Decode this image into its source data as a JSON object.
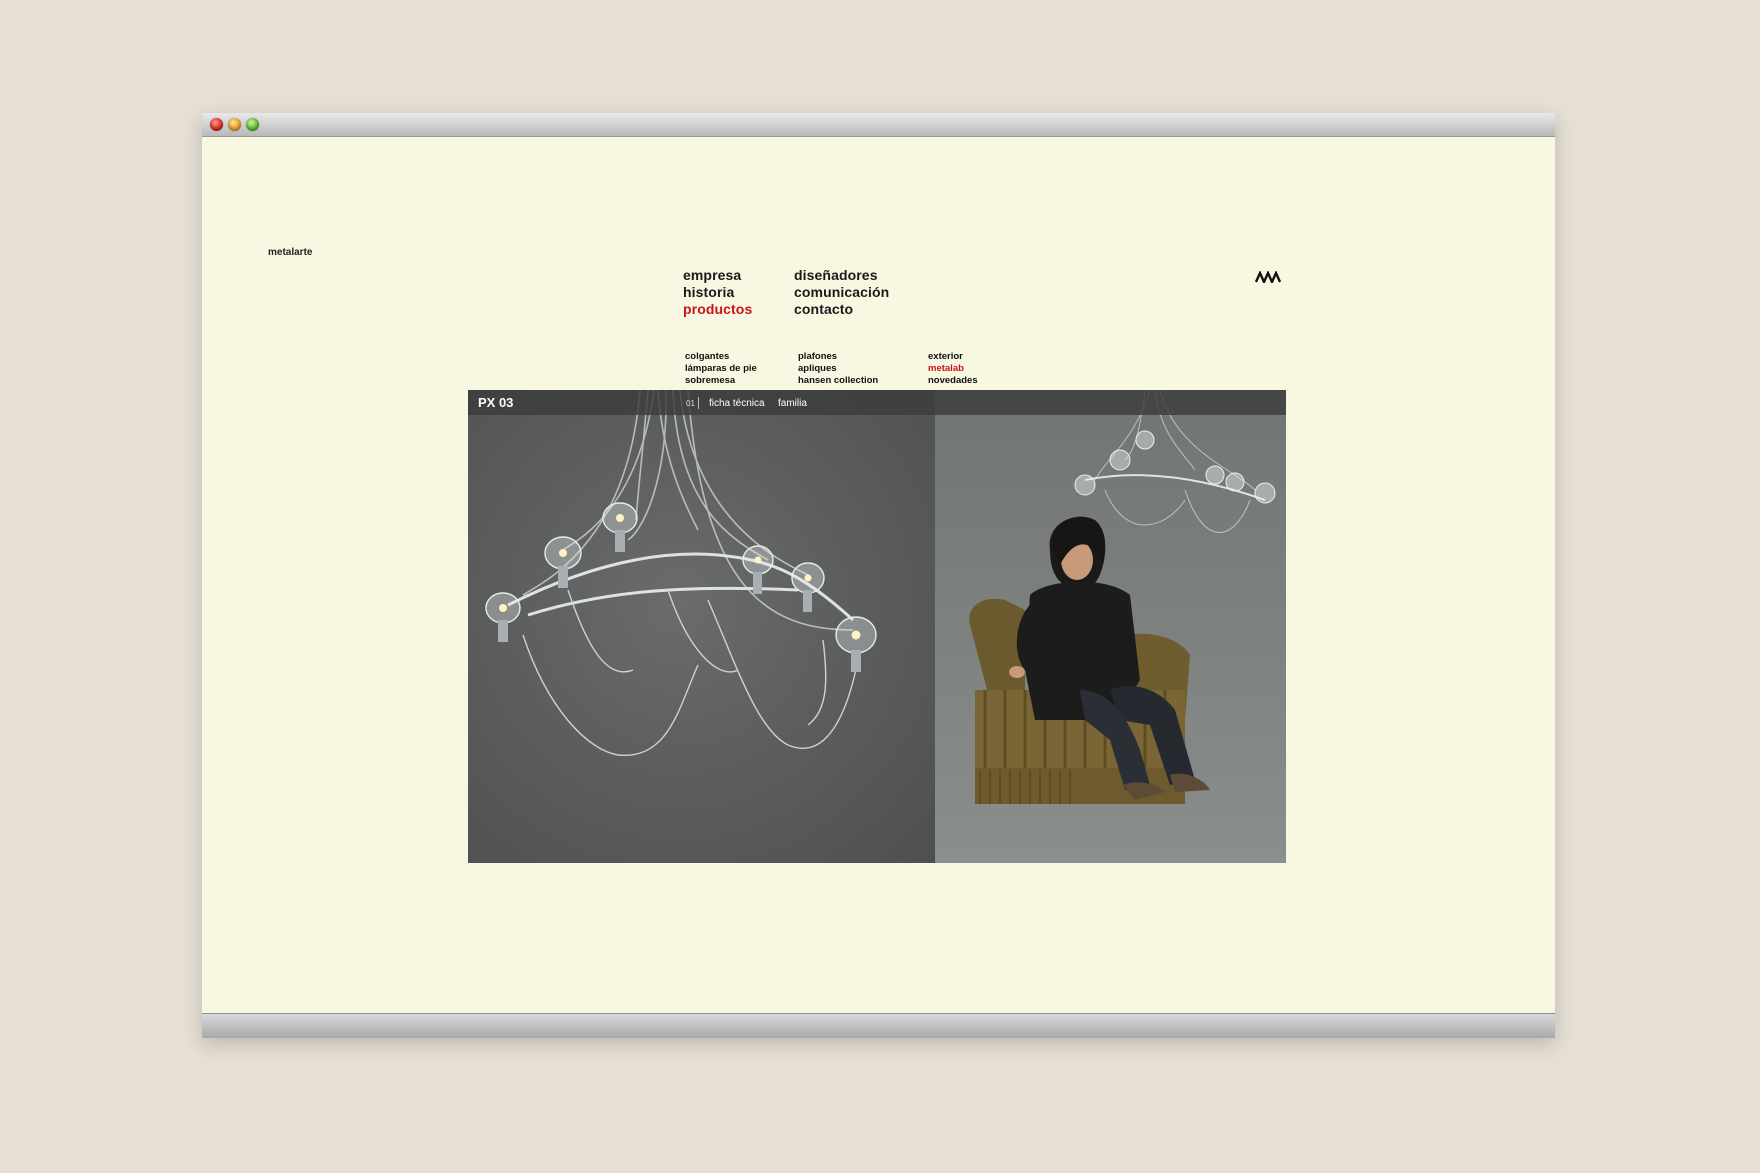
{
  "window": {
    "buttons": [
      "close",
      "minimize",
      "zoom"
    ]
  },
  "brand": {
    "logo_text": "metalarte",
    "logo_mark_icon": "metalarte-monogram-icon"
  },
  "main_nav": {
    "col1": [
      "empresa",
      "historia",
      "productos"
    ],
    "col2": [
      "diseñadores",
      "comunicación",
      "contacto"
    ],
    "active": "productos"
  },
  "sub_nav": {
    "col1": [
      "colgantes",
      "lámparas de pie",
      "sobremesa"
    ],
    "col2": [
      "plafones",
      "apliques",
      "hansen collection"
    ],
    "col3": [
      "exterior",
      "metalab",
      "novedades"
    ],
    "active": "metalab"
  },
  "product": {
    "code": "PX 03",
    "number": "01",
    "links": [
      "ficha técnica",
      "familia"
    ]
  },
  "colors": {
    "page_bg": "#f8f7e2",
    "active": "#c8141a",
    "text": "#1a1a1a"
  }
}
